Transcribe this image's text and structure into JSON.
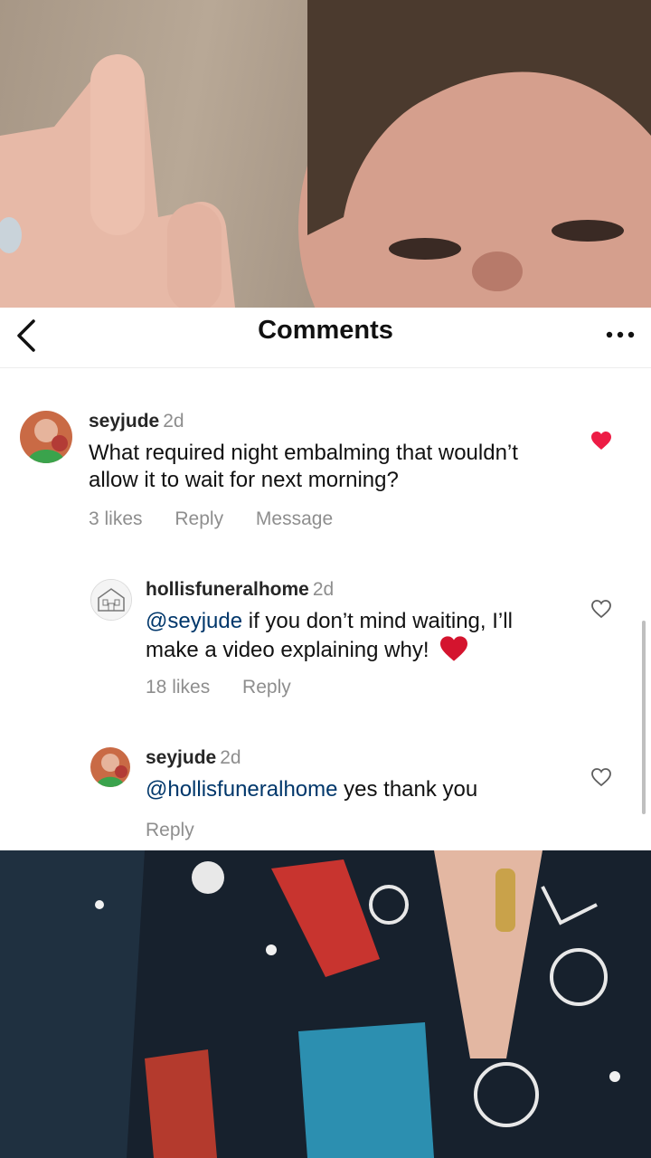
{
  "header": {
    "title": "Comments"
  },
  "comments": [
    {
      "username": "seyjude",
      "time": "2d",
      "text": "What required night embalming that wouldn’t allow it to wait for next morning?",
      "likes_label": "3 likes",
      "reply_label": "Reply",
      "message_label": "Message",
      "liked": true
    },
    {
      "username": "hollisfuneralhome",
      "time": "2d",
      "mention": "@seyjude",
      "text": " if you don’t mind waiting, I’ll make a video explaining why!",
      "likes_label": "18 likes",
      "reply_label": "Reply",
      "liked": false
    },
    {
      "username": "seyjude",
      "time": "2d",
      "mention": "@hollisfuneralhome",
      "text": " yes thank you",
      "reply_label": "Reply",
      "liked": false
    }
  ],
  "colors": {
    "liked_heart": "#ed1c45",
    "mention": "#00376b",
    "muted": "#8e8e8e"
  }
}
